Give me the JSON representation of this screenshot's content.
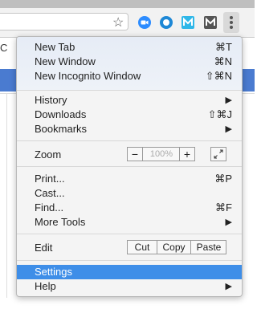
{
  "toolbar": {
    "extensions": [
      "blue-camera-icon",
      "blue-circle-icon",
      "cyan-m-icon",
      "gray-m-icon"
    ],
    "menu_button_icon": "vertical-dots-icon",
    "star_icon": "star-icon"
  },
  "page": {
    "left_char": "C"
  },
  "menu": {
    "new_tab": {
      "label": "New Tab",
      "shortcut": "⌘T"
    },
    "new_window": {
      "label": "New Window",
      "shortcut": "⌘N"
    },
    "new_incognito": {
      "label": "New Incognito Window",
      "shortcut": "⇧⌘N"
    },
    "history": {
      "label": "History",
      "submenu": "▶"
    },
    "downloads": {
      "label": "Downloads",
      "shortcut": "⇧⌘J"
    },
    "bookmarks": {
      "label": "Bookmarks",
      "submenu": "▶"
    },
    "zoom": {
      "label": "Zoom",
      "minus": "−",
      "value": "100%",
      "plus": "+"
    },
    "print": {
      "label": "Print...",
      "shortcut": "⌘P"
    },
    "cast": {
      "label": "Cast..."
    },
    "find": {
      "label": "Find...",
      "shortcut": "⌘F"
    },
    "more_tools": {
      "label": "More Tools",
      "submenu": "▶"
    },
    "edit": {
      "label": "Edit",
      "cut": "Cut",
      "copy": "Copy",
      "paste": "Paste"
    },
    "settings": {
      "label": "Settings"
    },
    "help": {
      "label": "Help",
      "submenu": "▶"
    }
  },
  "colors": {
    "highlight": "#3e8ee8",
    "page_bar": "#4a7bd0"
  }
}
